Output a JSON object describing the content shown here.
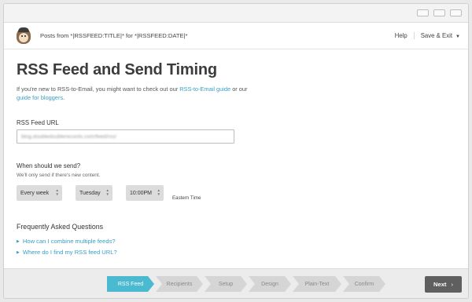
{
  "app": {
    "campaign_title": "Posts from *|RSSFEED:TITLE|* for *|RSSFEED:DATE|*",
    "help_label": "Help",
    "save_exit_label": "Save & Exit",
    "save_exit_icon": "chevron-down-icon"
  },
  "page": {
    "title": "RSS Feed and Send Timing",
    "intro_text_1": "If you're new to RSS-to-Email, you might want to check out our",
    "intro_link_1": "RSS-to-Email guide",
    "intro_text_2": "or our",
    "intro_link_2": "guide for bloggers",
    "intro_text_3": "."
  },
  "feed": {
    "label": "RSS Feed URL",
    "value": "blog.doubledoublerecords.com/feed/rss/"
  },
  "timing": {
    "question": "When should we send?",
    "hint": "We'll only send if there's new content.",
    "frequency": "Every week",
    "day": "Tuesday",
    "time": "10:00PM",
    "timezone": "Eastern Time"
  },
  "faq": {
    "title": "Frequently Asked Questions",
    "items": [
      "How can I combine multiple feeds?",
      "Where do I find my RSS feed URL?"
    ]
  },
  "wizard": {
    "steps": [
      "RSS Feed",
      "Recipients",
      "Setup",
      "Design",
      "Plain-Text",
      "Confirm"
    ],
    "active_step": "RSS Feed",
    "next_label": "Next",
    "next_icon": "chevron-right-icon",
    "accent_color": "#4bb9cf"
  }
}
